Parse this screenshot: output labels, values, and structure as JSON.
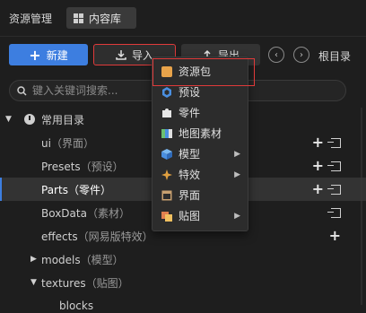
{
  "header": {
    "title": "资源管理",
    "tab_content": "内容库"
  },
  "toolbar": {
    "new_label": "新建",
    "import_label": "导入",
    "export_label": "导出",
    "root_label": "根目录"
  },
  "search": {
    "placeholder": "键入关键词搜索..."
  },
  "tree": {
    "root": "常用目录",
    "items": [
      {
        "name": "ui",
        "sub": "（界面）"
      },
      {
        "name": "Presets",
        "sub": "（预设）"
      },
      {
        "name": "Parts",
        "sub": "（零件）"
      },
      {
        "name": "BoxData",
        "sub": "（素材）"
      },
      {
        "name": "effects",
        "sub": "（网易版特效）"
      },
      {
        "name": "models",
        "sub": "（模型）"
      },
      {
        "name": "textures",
        "sub": "（贴图）"
      },
      {
        "name": "blocks",
        "sub": ""
      }
    ]
  },
  "menu": {
    "items": [
      {
        "label": "资源包",
        "icon": "package-icon",
        "color": "#e8a34a"
      },
      {
        "label": "预设",
        "icon": "hexagon-icon",
        "color": "#4a8fe0"
      },
      {
        "label": "零件",
        "icon": "puzzle-icon",
        "color": "#e6e6e6"
      },
      {
        "label": "地图素材",
        "icon": "map-icon",
        "color": "#6cc070"
      },
      {
        "label": "模型",
        "icon": "cube-icon",
        "color": "#5aa0e0"
      },
      {
        "label": "特效",
        "icon": "sparkle-icon",
        "color": "#e0a040"
      },
      {
        "label": "界面",
        "icon": "window-icon",
        "color": "#c8a070"
      },
      {
        "label": "贴图",
        "icon": "image-icon",
        "color": "#e08050"
      }
    ]
  },
  "colors": {
    "accent": "#3d7ee0",
    "highlight": "#e03a3a"
  }
}
